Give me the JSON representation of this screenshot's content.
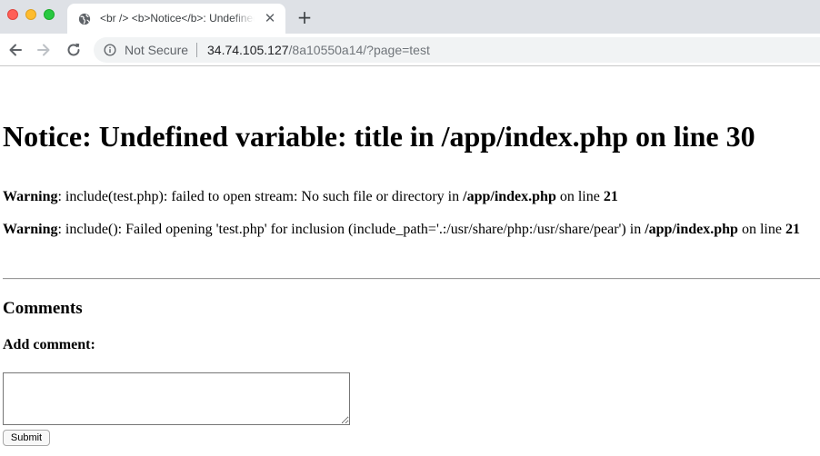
{
  "browser": {
    "tab": {
      "title": "<br /> <b>Notice</b>: Undefined variable: title in /app/index.php on line 30",
      "close_glyph": "✕",
      "favicon": "globe-icon"
    },
    "new_tab_glyph": "+",
    "toolbar": {
      "back_icon": "arrow-left-icon",
      "forward_icon": "arrow-right-icon",
      "reload_icon": "reload-icon"
    },
    "omnibox": {
      "security_label": "Not Secure",
      "url_host": "34.74.105.127",
      "url_path": "/8a10550a14/?page=test"
    }
  },
  "page": {
    "heading": "Notice: Undefined variable: title in /app/index.php on line 30",
    "warnings": [
      {
        "label": "Warning",
        "message": ": include(test.php): failed to open stream: No such file or directory in ",
        "file": "/app/index.php",
        "on_line_text": " on line ",
        "line": "21"
      },
      {
        "label": "Warning",
        "message": ": include(): Failed opening 'test.php' for inclusion (include_path='.:/usr/share/php:/usr/share/pear') in ",
        "file": "/app/index.php",
        "on_line_text": " on line ",
        "line": "21"
      }
    ],
    "comments_heading": "Comments",
    "add_comment_label": "Add comment:",
    "comment_value": "",
    "submit_label": "Submit"
  },
  "colors": {
    "tabstrip_bg": "#dee1e6",
    "omnibox_bg": "#f1f3f4",
    "traffic_close": "#ff5f57",
    "traffic_minimize": "#febc2e",
    "traffic_maximize": "#28c840"
  }
}
